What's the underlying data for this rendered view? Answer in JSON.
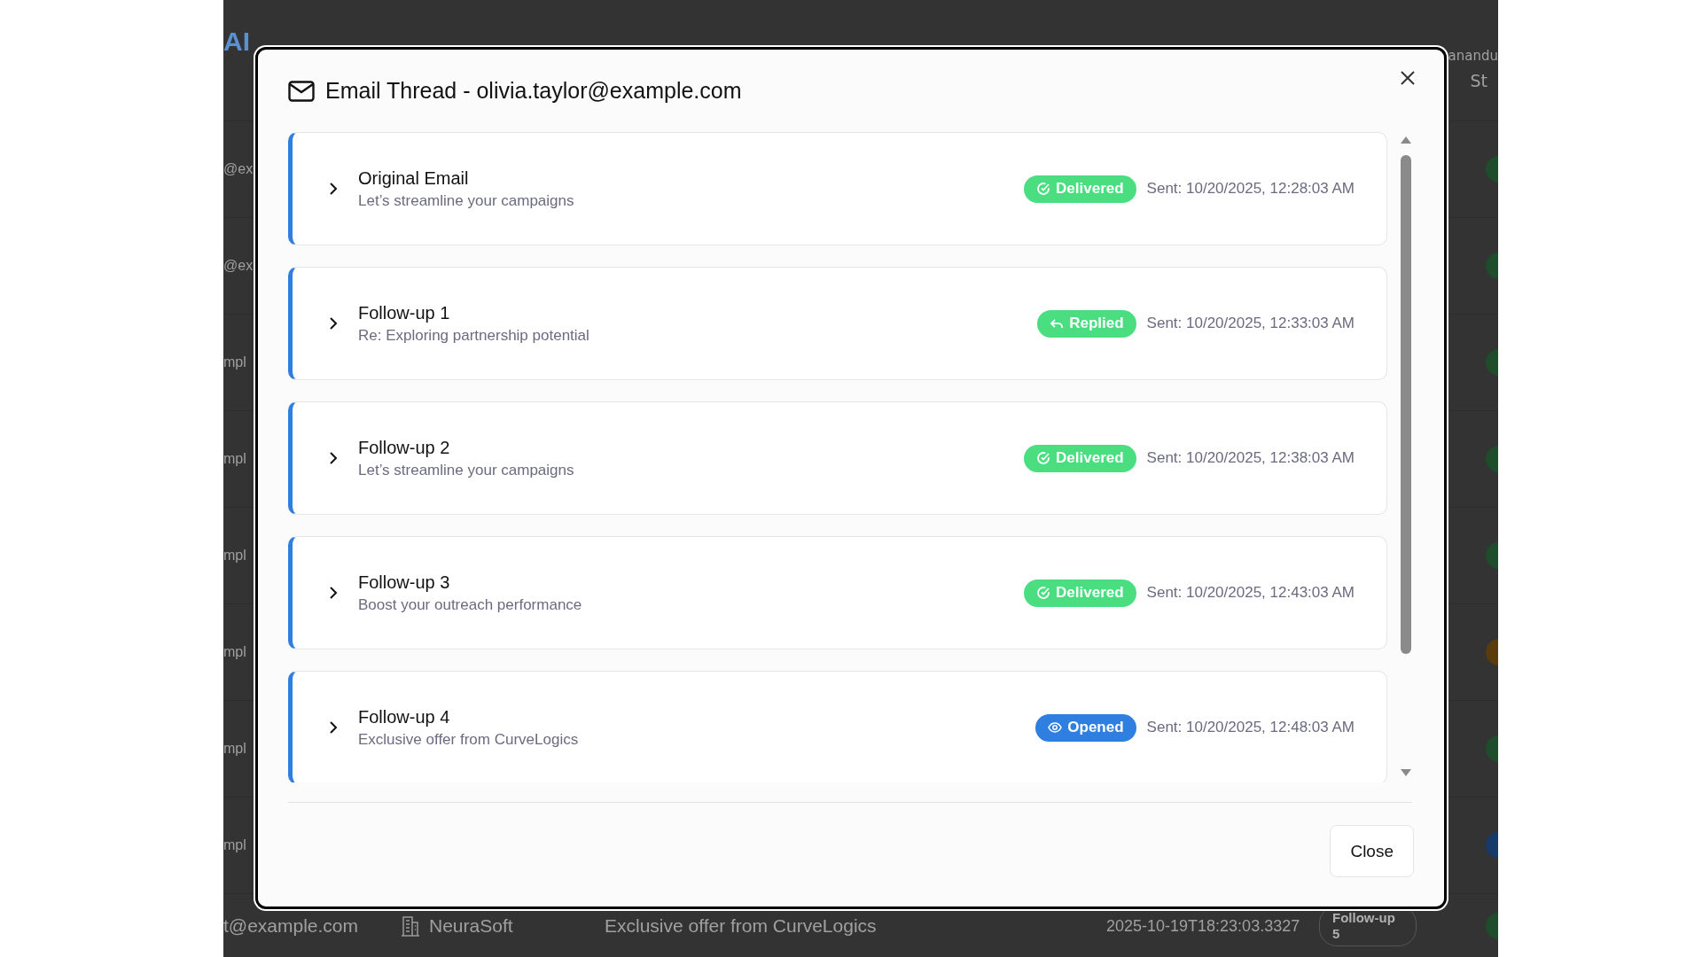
{
  "background": {
    "brand": "AI",
    "user": "anandu",
    "column_heading": "St",
    "rows": [
      {
        "text": "@ex",
        "color": "#1f4d2c"
      },
      {
        "text": "@ex",
        "color": "#1f4d2c"
      },
      {
        "text": "mpl",
        "color": "#1f4d2c"
      },
      {
        "text": "mpl",
        "color": "#1f4d2c"
      },
      {
        "text": "mpl",
        "color": "#1f4d2c"
      },
      {
        "text": "mpl",
        "color": "#5a3b0c"
      },
      {
        "text": "mpl",
        "color": "#1f4d2c"
      },
      {
        "text": "mpl",
        "color": "#173a6b"
      }
    ],
    "last_row": {
      "email": "t@example.com",
      "company": "NeuraSoft",
      "subject": "Exclusive offer from CurveLogics",
      "date": "2025-10-19T18:23:03.3327",
      "stage": "Follow-up 5",
      "color": "#1f4d2c"
    }
  },
  "dialog": {
    "title": "Email Thread - olivia.taylor@example.com",
    "emails": [
      {
        "title": "Original Email",
        "subject": "Let’s streamline your campaigns",
        "kind": "delivered",
        "badge": "Delivered",
        "sent": "Sent: 10/20/2025, 12:28:03 AM",
        "expanded": false
      },
      {
        "title": "Follow-up 1",
        "subject": "Re: Exploring partnership potential",
        "kind": "replied",
        "badge": "Replied",
        "sent": "Sent: 10/20/2025, 12:33:03 AM",
        "expanded": false
      },
      {
        "title": "Follow-up 2",
        "subject": "Let’s streamline your campaigns",
        "kind": "delivered",
        "badge": "Delivered",
        "sent": "Sent: 10/20/2025, 12:38:03 AM",
        "expanded": false
      },
      {
        "title": "Follow-up 3",
        "subject": "Boost your outreach performance",
        "kind": "delivered",
        "badge": "Delivered",
        "sent": "Sent: 10/20/2025, 12:43:03 AM",
        "expanded": false
      },
      {
        "title": "Follow-up 4",
        "subject": "Exclusive offer from CurveLogics",
        "kind": "opened",
        "badge": "Opened",
        "sent": "Sent: 10/20/2025, 12:48:03 AM",
        "expanded": false
      }
    ],
    "close_button": "Close"
  }
}
